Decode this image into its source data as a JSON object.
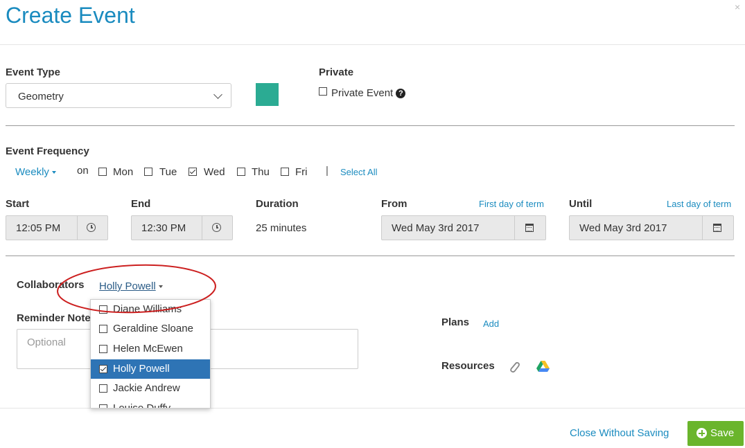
{
  "dialog": {
    "title": "Create Event",
    "close_icon": "×"
  },
  "event_type": {
    "label": "Event Type",
    "value": "Geometry",
    "color": "#2bab93"
  },
  "private": {
    "label": "Private",
    "checkbox_label": "Private Event",
    "checked": false,
    "help_icon": "?"
  },
  "frequency": {
    "label": "Event Frequency",
    "value": "Weekly",
    "on_label": "on",
    "days": [
      {
        "label": "Mon",
        "checked": false
      },
      {
        "label": "Tue",
        "checked": false
      },
      {
        "label": "Wed",
        "checked": true
      },
      {
        "label": "Thu",
        "checked": false
      },
      {
        "label": "Fri",
        "checked": false
      }
    ],
    "divider": "|",
    "select_all": "Select All"
  },
  "start": {
    "label": "Start",
    "value": "12:05 PM"
  },
  "end": {
    "label": "End",
    "value": "12:30 PM"
  },
  "duration": {
    "label": "Duration",
    "value": "25 minutes"
  },
  "from": {
    "label": "From",
    "link": "First day of term",
    "value": "Wed May 3rd 2017"
  },
  "until": {
    "label": "Until",
    "link": "Last day of term",
    "value": "Wed May 3rd 2017"
  },
  "collaborators": {
    "label": "Collaborators",
    "value": "Holly Powell",
    "options": [
      {
        "name": "Diane Williams",
        "checked": false
      },
      {
        "name": "Geraldine Sloane",
        "checked": false
      },
      {
        "name": "Helen McEwen",
        "checked": false
      },
      {
        "name": "Holly Powell",
        "checked": true
      },
      {
        "name": "Jackie Andrew",
        "checked": false
      },
      {
        "name": "Louise Duffy",
        "checked": false
      }
    ]
  },
  "reminder": {
    "label": "Reminder Notes",
    "placeholder": "Optional"
  },
  "plans": {
    "label": "Plans",
    "add": "Add"
  },
  "resources": {
    "label": "Resources",
    "icons": [
      "paperclip-icon",
      "google-drive-icon"
    ]
  },
  "footer": {
    "close_without_saving": "Close Without Saving",
    "save": "Save",
    "save_color": "#6ab52c"
  },
  "annotation": {
    "color": "#cc1f1f"
  }
}
